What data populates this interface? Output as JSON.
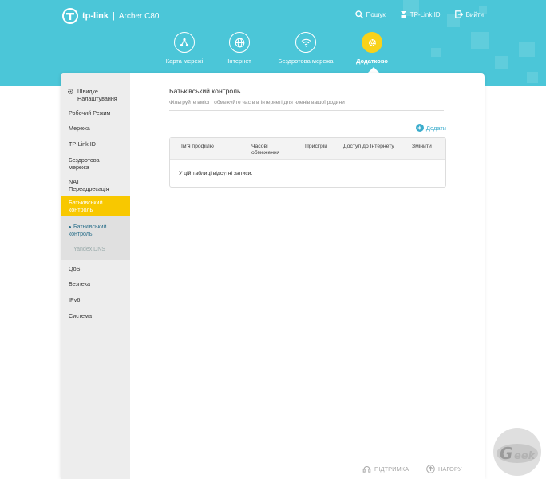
{
  "header": {
    "brand": "tp-link",
    "model": "Archer C80",
    "links": [
      {
        "label": "Пошук",
        "icon": "search-icon"
      },
      {
        "label": "TP-Link ID",
        "icon": "tplink-id-icon"
      },
      {
        "label": "Вийти",
        "icon": "logout-icon"
      }
    ]
  },
  "nav": {
    "items": [
      {
        "label": "Карта мережі",
        "icon": "network-map-icon"
      },
      {
        "label": "Інтернет",
        "icon": "globe-icon"
      },
      {
        "label": "Бездротова мережа",
        "icon": "wifi-icon"
      },
      {
        "label": "Додатково",
        "icon": "gear-icon",
        "active": true
      }
    ]
  },
  "sidebar": {
    "items": [
      {
        "label": "Швидке Налаштування",
        "icon": "gear-icon"
      },
      {
        "label": "Робочий Режим"
      },
      {
        "label": "Мережа"
      },
      {
        "label": "TP-Link ID"
      },
      {
        "label": "Бездротова мережа"
      },
      {
        "label": "NAT Переадресація"
      },
      {
        "label": "Батьківський контроль",
        "active": true
      },
      {
        "label": "QoS"
      },
      {
        "label": "Безпека"
      },
      {
        "label": "IPv6"
      },
      {
        "label": "Система"
      }
    ],
    "sub_items": [
      {
        "label": "Батьківський контроль",
        "current": true
      },
      {
        "label": "Yandex.DNS"
      }
    ]
  },
  "content": {
    "title": "Батьківський контроль",
    "description": "Фільтруйте вміст і обмежуйте час в в Інтернеті для членів вашої родини",
    "add_label": "Додати",
    "table": {
      "columns": [
        "Ім'я профілю",
        "Часові обмеження",
        "Пристрій",
        "Доступ до Інтернету",
        "Змінити"
      ],
      "empty_text": "У цій таблиці відсутні записи."
    }
  },
  "footer": {
    "support": "ПІДТРИМКА",
    "top": "НАГОРУ"
  },
  "colors": {
    "header": "#4bc6d8",
    "accent": "#f8c800",
    "link": "#3aaccc"
  }
}
